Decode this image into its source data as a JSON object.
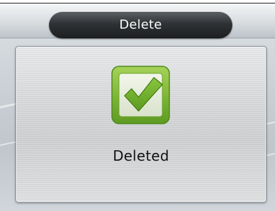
{
  "dialog": {
    "title": "Delete",
    "message": "Deleted",
    "icon": "checkmark-success-icon",
    "accent_color": "#7ab334"
  }
}
